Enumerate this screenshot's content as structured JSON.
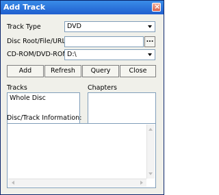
{
  "window": {
    "title": "Add Track"
  },
  "form": {
    "track_type_label": "Track Type",
    "track_type_value": "DVD",
    "disc_root_label": "Disc Root/File/URL",
    "disc_root_value": "",
    "browse_label": "...",
    "drive_label": "CD-ROM/DVD-ROM",
    "drive_value": "D:\\"
  },
  "buttons": {
    "add": "Add",
    "refresh": "Refresh",
    "query": "Query",
    "close": "Close"
  },
  "tracks": {
    "label": "Tracks",
    "items": [
      "Whole Disc"
    ]
  },
  "chapters": {
    "label": "Chapters"
  },
  "info": {
    "label": "Disc/Track Information:",
    "text": ""
  }
}
